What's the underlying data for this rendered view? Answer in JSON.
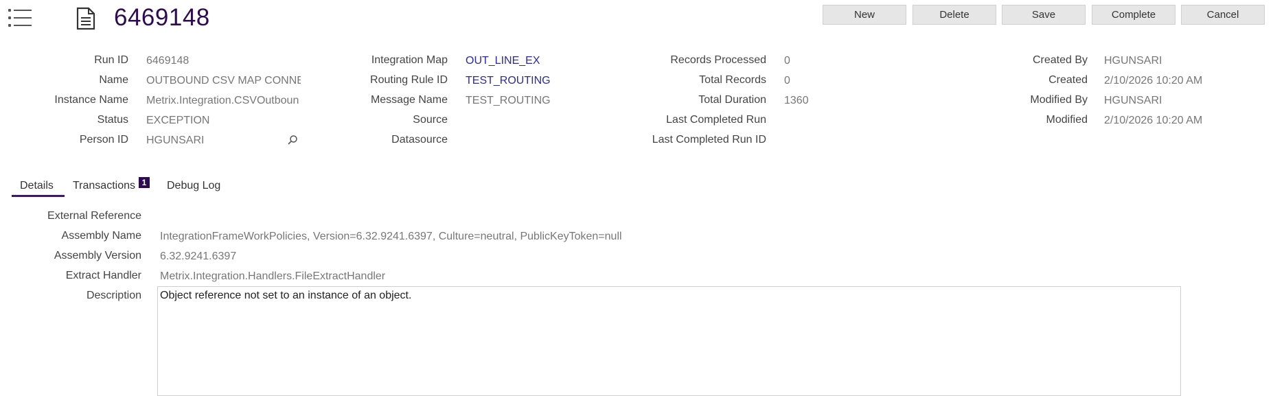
{
  "header": {
    "title": "6469148",
    "buttons": {
      "new": "New",
      "delete": "Delete",
      "save": "Save",
      "complete": "Complete",
      "cancel": "Cancel"
    }
  },
  "fields": {
    "col1": [
      {
        "label": "Run ID",
        "value": "6469148"
      },
      {
        "label": "Name",
        "value": "OUTBOUND CSV MAP CONNEC"
      },
      {
        "label": "Instance Name",
        "value": "Metrix.Integration.CSVOutboun"
      },
      {
        "label": "Status",
        "value": "EXCEPTION"
      },
      {
        "label": "Person ID",
        "value": "HGUNSARI"
      }
    ],
    "col2": [
      {
        "label": "Integration Map",
        "value": "OUT_LINE_EX"
      },
      {
        "label": "Routing Rule ID",
        "value": "TEST_ROUTING"
      },
      {
        "label": "Message Name",
        "value": "TEST_ROUTING"
      },
      {
        "label": "Source",
        "value": ""
      },
      {
        "label": "Datasource",
        "value": ""
      }
    ],
    "col3": [
      {
        "label": "Records Processed",
        "value": "0"
      },
      {
        "label": "Total Records",
        "value": "0"
      },
      {
        "label": "Total Duration",
        "value": "1360"
      },
      {
        "label": "Last Completed Run",
        "value": ""
      },
      {
        "label": "Last Completed Run ID",
        "value": ""
      }
    ],
    "col4": [
      {
        "label": "Created By",
        "value": "HGUNSARI"
      },
      {
        "label": "Created",
        "value": "2/10/2026 10:20 AM"
      },
      {
        "label": "Modified By",
        "value": "HGUNSARI"
      },
      {
        "label": "Modified",
        "value": "2/10/2026 10:20 AM"
      }
    ]
  },
  "tabs": [
    {
      "label": "Details"
    },
    {
      "label": "Transactions",
      "badge": "1"
    },
    {
      "label": "Debug Log"
    }
  ],
  "details": {
    "external_reference": {
      "label": "External Reference",
      "value": ""
    },
    "assembly_name": {
      "label": "Assembly Name",
      "value": "IntegrationFrameWorkPolicies, Version=6.32.9241.6397, Culture=neutral, PublicKeyToken=null"
    },
    "assembly_version": {
      "label": "Assembly Version",
      "value": "6.32.9241.6397"
    },
    "extract_handler": {
      "label": "Extract Handler",
      "value": "Metrix.Integration.Handlers.FileExtractHandler"
    },
    "description": {
      "label": "Description",
      "value": "Object reference not set to an instance of an object."
    }
  },
  "colors": {
    "accent": "#2e0a52",
    "link": "#2a2aa0",
    "button_bg": "#e6e6e6"
  },
  "icons": {
    "menu": "list-menu-icon",
    "document": "document-icon",
    "search": "search-icon"
  }
}
